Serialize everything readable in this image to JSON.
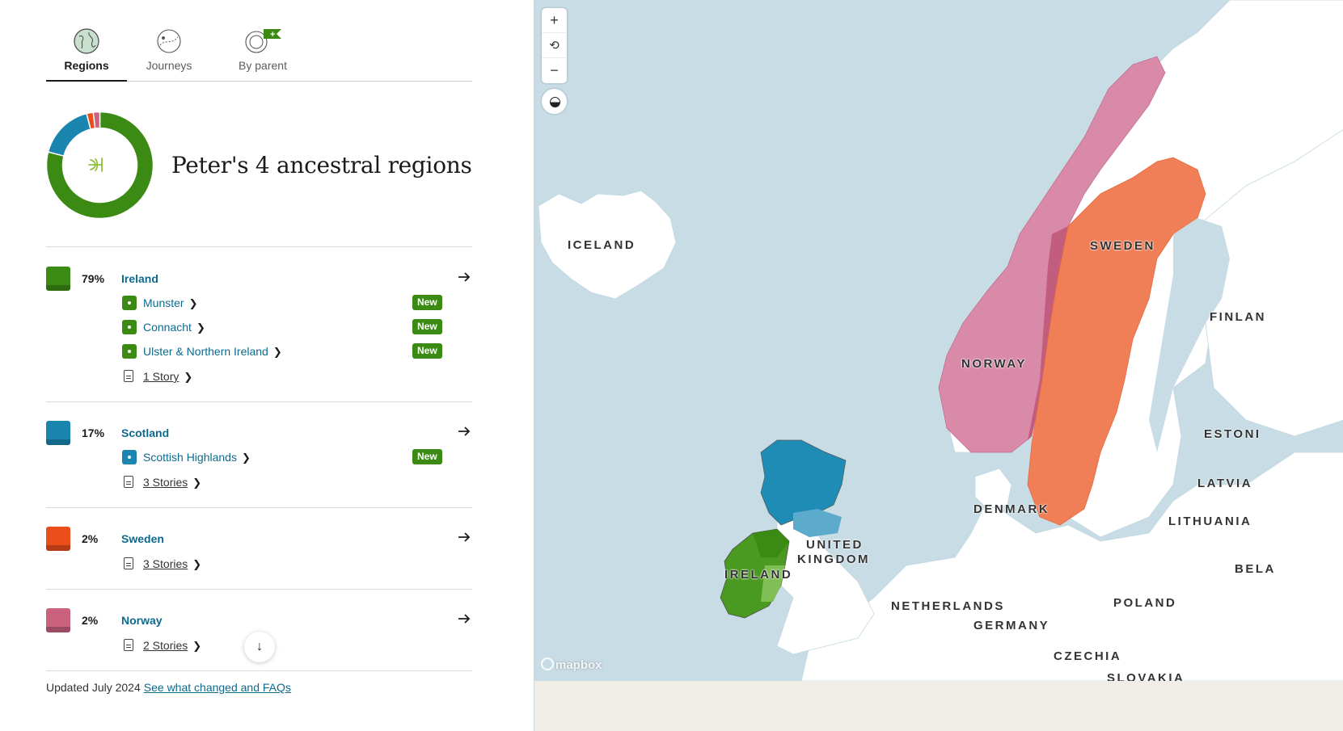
{
  "tabs": [
    {
      "label": "Regions",
      "icon": "globe-icon",
      "active": true
    },
    {
      "label": "Journeys",
      "icon": "journeys-icon",
      "active": false
    },
    {
      "label": "By parent",
      "icon": "by-parent-icon",
      "badge": "+",
      "active": false
    }
  ],
  "summary": {
    "title": "Peter's 4 ancestral regions",
    "center_icon": "ancestry-leaf-icon"
  },
  "chart_data": {
    "type": "pie",
    "categories": [
      "Ireland",
      "Scotland",
      "Sweden",
      "Norway"
    ],
    "values": [
      79,
      17,
      2,
      2
    ],
    "colors": [
      "#3a8a13",
      "#1a86b0",
      "#e94e1b",
      "#c9617f"
    ]
  },
  "regions": [
    {
      "percent": "79%",
      "name": "Ireland",
      "color": "#3a8a13",
      "subregions": [
        {
          "name": "Munster",
          "badge": "New"
        },
        {
          "name": "Connacht",
          "badge": "New"
        },
        {
          "name": "Ulster & Northern Ireland",
          "badge": "New"
        }
      ],
      "stories": "1 Story"
    },
    {
      "percent": "17%",
      "name": "Scotland",
      "color": "#1a86b0",
      "subregions": [
        {
          "name": "Scottish Highlands",
          "badge": "New"
        }
      ],
      "stories": "3 Stories"
    },
    {
      "percent": "2%",
      "name": "Sweden",
      "color": "#e94e1b",
      "subregions": [],
      "stories": "3 Stories"
    },
    {
      "percent": "2%",
      "name": "Norway",
      "color": "#c9617f",
      "subregions": [],
      "stories": "2 Stories"
    }
  ],
  "footer": {
    "updated": "Updated July 2024",
    "link": "See what changed and FAQs"
  },
  "map": {
    "controls": {
      "zoom_in": "+",
      "reset": "⟲",
      "zoom_out": "−"
    },
    "attribution": "mapbox",
    "labels": [
      "ICELAND",
      "SWEDEN",
      "FINLAN",
      "NORWAY",
      "ESTONI",
      "LATVIA",
      "DENMARK",
      "LITHUANIA",
      "UNITED",
      "KINGDOM",
      "IRELAND",
      "BELA",
      "POLAND",
      "NETHERLANDS",
      "GERMANY",
      "CZECHIA",
      "SLOVAKIA"
    ],
    "colors": {
      "water": "#c7dce5",
      "land": "#ffffff"
    }
  }
}
